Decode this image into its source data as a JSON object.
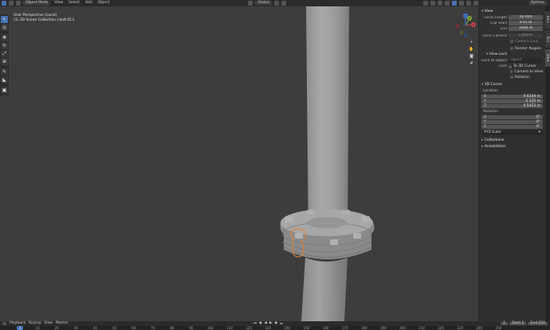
{
  "header": {
    "mode": "Object Mode",
    "menus": [
      "View",
      "Select",
      "Add",
      "Object"
    ],
    "transform_orientation": "Global",
    "options_label": "Options"
  },
  "viewport": {
    "view_name": "User Perspective (Local)",
    "collection_info": "(1) 3D Scene Collection | bolt.013"
  },
  "gizmo": {
    "x_label": "X",
    "y_label": "Y",
    "z_label": "Z"
  },
  "sidebar": {
    "view_panel": {
      "title": "View",
      "focal_length_label": "Focal Length",
      "focal_length_value": "50 mm",
      "clip_start_label": "Clip Start",
      "clip_start_value": "0.01 m",
      "clip_end_label": "End",
      "clip_end_value": "1000 m",
      "local_camera_label": "Local Camera",
      "local_camera_value": "Camera",
      "camera_lock_label": "Camera Lock",
      "render_region_label": "Render Region"
    },
    "view_lock": {
      "title": "View Lock",
      "lock_to_object_label": "Lock to Object",
      "lock_to_object_placeholder": "Object",
      "lock_label": "Lock",
      "to_3d_cursor_label": "To 3D Cursor",
      "camera_to_view_label": "Camera to View",
      "rotation_label": "Rotation"
    },
    "cursor_panel": {
      "title": "3D Cursor",
      "location_label": "Location",
      "location": [
        {
          "axis": "X",
          "value": "0.6344 m"
        },
        {
          "axis": "Y",
          "value": "3.125 m"
        },
        {
          "axis": "Z",
          "value": "0.5423 m"
        }
      ],
      "rotation_label": "Rotation",
      "rotation": [
        {
          "axis": "X",
          "value": "0°"
        },
        {
          "axis": "Y",
          "value": "0°"
        },
        {
          "axis": "Z",
          "value": "0°"
        }
      ],
      "rotation_mode": "XYZ Euler"
    },
    "collections_label": "Collections",
    "annotations_label": "Annotations",
    "tabs": [
      "Item",
      "Tool",
      "View"
    ]
  },
  "timeline": {
    "menus": [
      "Playback",
      "Keying",
      "View",
      "Marker"
    ],
    "ticks": [
      "0",
      "10",
      "20",
      "30",
      "40",
      "50",
      "60",
      "70",
      "80",
      "90",
      "100",
      "110",
      "120",
      "130",
      "140",
      "150",
      "160",
      "170",
      "180",
      "190",
      "200",
      "210",
      "220",
      "230",
      "240",
      "250"
    ],
    "current_frame": "1",
    "frame_field": "1",
    "start_label": "Start",
    "start_value": "1",
    "end_label": "End",
    "end_value": "250"
  },
  "colors": {
    "accent": "#4772b3",
    "background": "#3d3d3d",
    "selection": "#e8812f"
  }
}
